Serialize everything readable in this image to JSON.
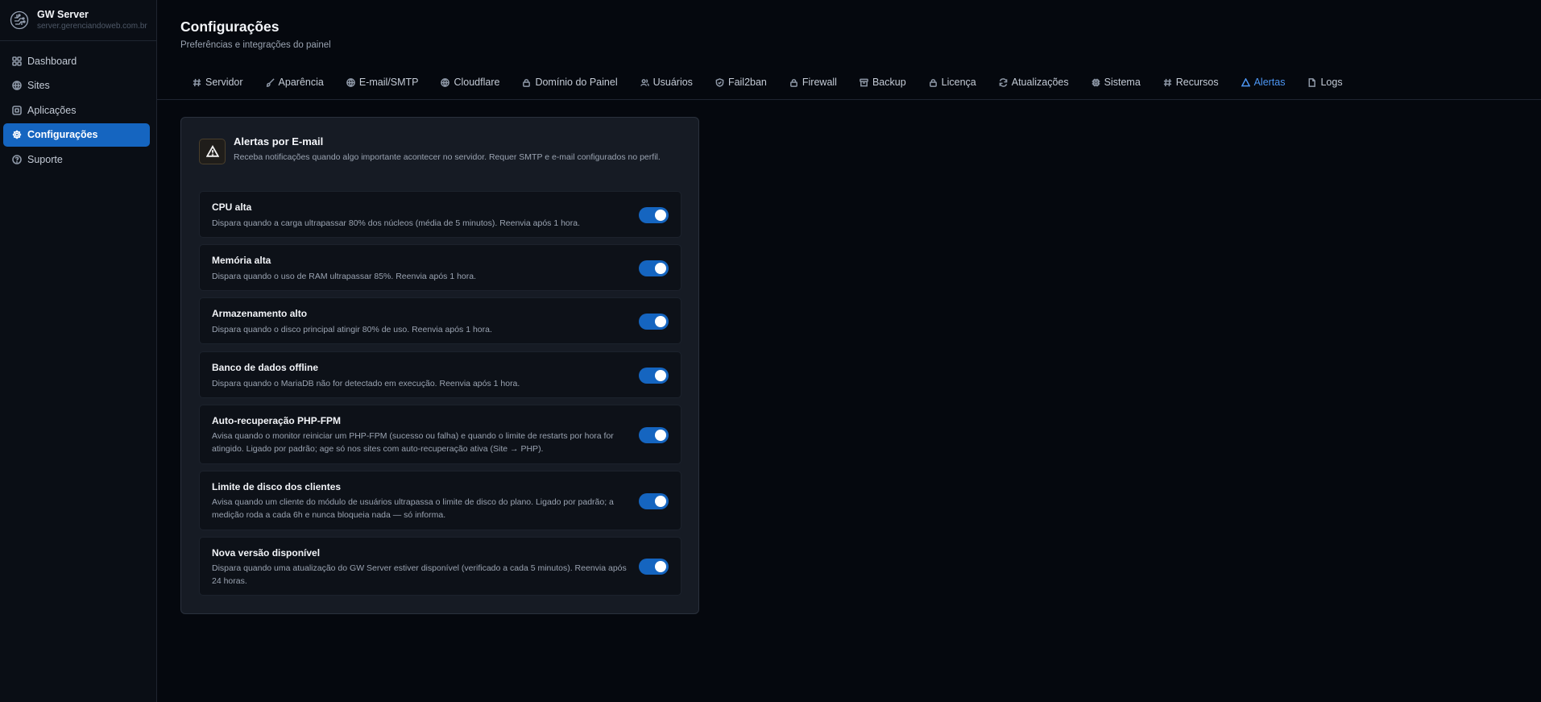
{
  "brand": {
    "title": "GW Server",
    "subtitle": "server.gerenciandoweb.com.br"
  },
  "sidebar": {
    "items": [
      {
        "label": "Dashboard",
        "icon": "grid-icon"
      },
      {
        "label": "Sites",
        "icon": "globe-icon"
      },
      {
        "label": "Aplicações",
        "icon": "app-icon"
      },
      {
        "label": "Configurações",
        "icon": "gear-icon",
        "active": true
      },
      {
        "label": "Suporte",
        "icon": "help-icon"
      }
    ]
  },
  "header": {
    "title": "Configurações",
    "subtitle": "Preferências e integrações do painel"
  },
  "tabs": [
    {
      "label": "Servidor",
      "icon": "hash-icon"
    },
    {
      "label": "Aparência",
      "icon": "brush-icon"
    },
    {
      "label": "E-mail/SMTP",
      "icon": "globe-icon"
    },
    {
      "label": "Cloudflare",
      "icon": "globe-icon"
    },
    {
      "label": "Domínio do Painel",
      "icon": "lock-icon"
    },
    {
      "label": "Usuários",
      "icon": "users-icon"
    },
    {
      "label": "Fail2ban",
      "icon": "shield-icon"
    },
    {
      "label": "Firewall",
      "icon": "lock-icon"
    },
    {
      "label": "Backup",
      "icon": "archive-icon"
    },
    {
      "label": "Licença",
      "icon": "lock-icon"
    },
    {
      "label": "Atualizações",
      "icon": "refresh-icon"
    },
    {
      "label": "Sistema",
      "icon": "chip-icon"
    },
    {
      "label": "Recursos",
      "icon": "hash-icon"
    },
    {
      "label": "Alertas",
      "icon": "warning-icon",
      "active": true
    },
    {
      "label": "Logs",
      "icon": "file-icon"
    }
  ],
  "card": {
    "title": "Alertas por E-mail",
    "description": "Receba notificações quando algo importante acontecer no servidor. Requer SMTP e e-mail configurados no perfil.",
    "alerts": [
      {
        "title": "CPU alta",
        "description": "Dispara quando a carga ultrapassar 80% dos núcleos (média de 5 minutos). Reenvia após 1 hora.",
        "enabled": true
      },
      {
        "title": "Memória alta",
        "description": "Dispara quando o uso de RAM ultrapassar 85%. Reenvia após 1 hora.",
        "enabled": true
      },
      {
        "title": "Armazenamento alto",
        "description": "Dispara quando o disco principal atingir 80% de uso. Reenvia após 1 hora.",
        "enabled": true
      },
      {
        "title": "Banco de dados offline",
        "description": "Dispara quando o MariaDB não for detectado em execução. Reenvia após 1 hora.",
        "enabled": true
      },
      {
        "title": "Auto-recuperação PHP-FPM",
        "description": "Avisa quando o monitor reiniciar um PHP-FPM (sucesso ou falha) e quando o limite de restarts por hora for atingido. Ligado por padrão; age só nos sites com auto-recuperação ativa (Site → PHP).",
        "enabled": true
      },
      {
        "title": "Limite de disco dos clientes",
        "description": "Avisa quando um cliente do módulo de usuários ultrapassa o limite de disco do plano. Ligado por padrão; a medição roda a cada 6h e nunca bloqueia nada — só informa.",
        "enabled": true
      },
      {
        "title": "Nova versão disponível",
        "description": "Dispara quando uma atualização do GW Server estiver disponível (verificado a cada 5 minutos). Reenvia após 24 horas.",
        "enabled": true
      }
    ]
  },
  "colors": {
    "accent": "#1565c0",
    "active_tab": "#4d97f5",
    "background": "#05080e"
  }
}
